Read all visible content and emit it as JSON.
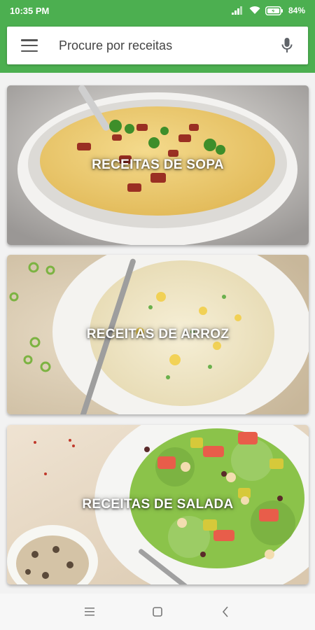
{
  "status_bar": {
    "time": "10:35 PM",
    "battery": "84%"
  },
  "search": {
    "placeholder": "Procure por receitas",
    "menu_icon": "hamburger-menu-icon",
    "mic_icon": "microphone-icon"
  },
  "cards": [
    {
      "title": "RECEITAS DE SOPA"
    },
    {
      "title": "RECEITAS DE ARROZ"
    },
    {
      "title": "RECEITAS DE SALADA"
    }
  ],
  "nav": {
    "icons": [
      "recents-icon",
      "home-icon",
      "back-icon"
    ]
  },
  "colors": {
    "accent": "#4caf50",
    "background": "#f2f2f2"
  }
}
